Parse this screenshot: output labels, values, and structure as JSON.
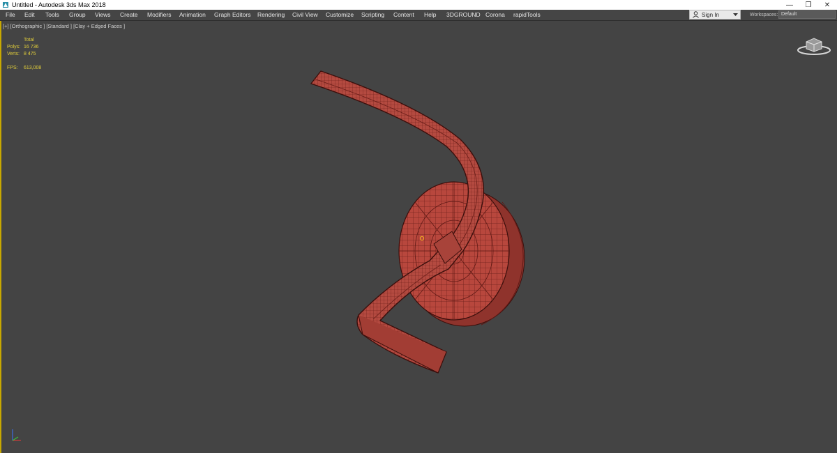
{
  "window": {
    "title": "Untitled - Autodesk 3ds Max 2018",
    "controls": {
      "minimize": "—",
      "restore": "❐",
      "close": "✕"
    }
  },
  "menu": [
    "File",
    "Edit",
    "Tools",
    "Group",
    "Views",
    "Create",
    "Modifiers",
    "Animation",
    "Graph Editors",
    "Rendering",
    "Civil View",
    "Customize",
    "Scripting",
    "Content",
    "Help",
    "3DGROUND",
    "Corona",
    "rapidTools"
  ],
  "account": {
    "signin_label": "Sign In"
  },
  "workspaces": {
    "label": "Workspaces:",
    "value": "Default"
  },
  "viewport": {
    "label": "[+] [Orthographic ] [Standard ] [Clay + Edged Faces ]",
    "stats": {
      "header": "Total",
      "polys_label": "Polys:",
      "polys_value": "16 736",
      "verts_label": "Verts:",
      "verts_value": "8 475",
      "fps_label": "FPS:",
      "fps_value": "613,008"
    }
  },
  "colors": {
    "viewport_bg": "#444444",
    "model": "#b8473d",
    "stats_text": "#e3cf3a",
    "active_border": "#c8a800"
  }
}
